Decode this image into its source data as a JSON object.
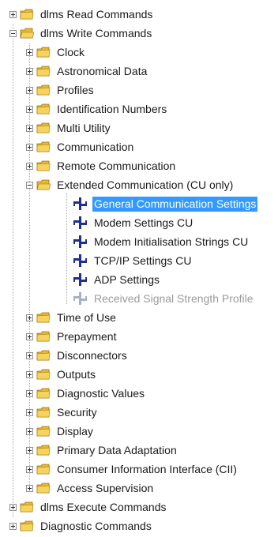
{
  "tree": {
    "root_items": [
      {
        "label": "dlms Read Commands",
        "expanded": false
      },
      {
        "label": "dlms Write Commands",
        "expanded": true
      },
      {
        "label": "dlms Execute Commands",
        "expanded": false
      },
      {
        "label": "Diagnostic Commands",
        "expanded": false
      }
    ],
    "write_children": [
      {
        "label": "Clock"
      },
      {
        "label": "Astronomical Data"
      },
      {
        "label": "Profiles"
      },
      {
        "label": "Identification Numbers"
      },
      {
        "label": "Multi Utility"
      },
      {
        "label": "Communication"
      },
      {
        "label": "Remote Communication"
      },
      {
        "label": "Extended Communication (CU only)",
        "expanded": true
      },
      {
        "label": "Time of Use"
      },
      {
        "label": "Prepayment"
      },
      {
        "label": "Disconnectors"
      },
      {
        "label": "Outputs"
      },
      {
        "label": "Diagnostic Values"
      },
      {
        "label": "Security"
      },
      {
        "label": "Display"
      },
      {
        "label": "Primary Data Adaptation"
      },
      {
        "label": "Consumer Information Interface (CII)"
      },
      {
        "label": "Access Supervision"
      }
    ],
    "extended_children": [
      {
        "label": "General Communication Settings",
        "selected": true
      },
      {
        "label": "Modem Settings CU"
      },
      {
        "label": "Modem Initialisation Strings CU"
      },
      {
        "label": "TCP/IP Settings CU"
      },
      {
        "label": "ADP Settings"
      },
      {
        "label": "Received Signal Strength Profile",
        "disabled": true
      }
    ]
  },
  "colors": {
    "selection": "#3399ff",
    "folder": "#e8b830",
    "command_icon": "#1f2f8f",
    "disabled_text": "#9a9a9a"
  }
}
